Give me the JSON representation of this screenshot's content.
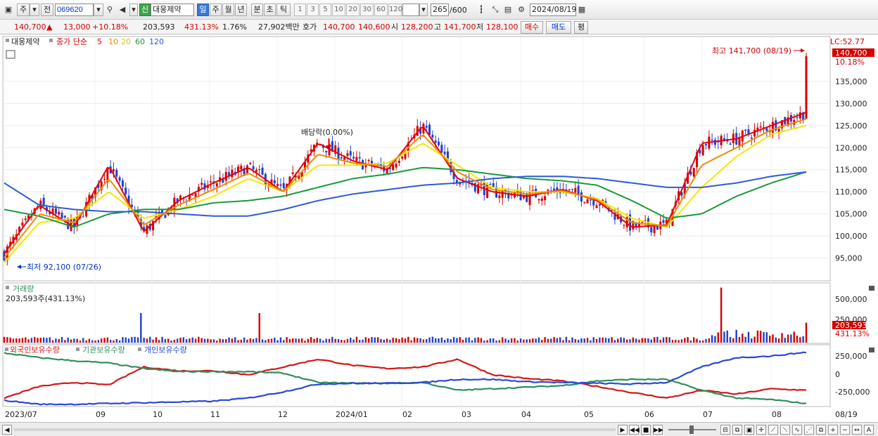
{
  "toolbar": {
    "period_type": "주",
    "compare": "전",
    "stock_code": "069620",
    "badge_new": "신",
    "stock_name": "대웅제약",
    "periods": [
      "일",
      "주",
      "월",
      "년",
      "분",
      "초",
      "틱"
    ],
    "active_period": "일",
    "intervals": [
      "1",
      "3",
      "5",
      "10",
      "20",
      "30",
      "60",
      "120"
    ],
    "count": "265",
    "count_total": "/600",
    "date": "2024/08/19"
  },
  "quote": {
    "price": "140,700",
    "change_arrow": "▲",
    "change": "13,000",
    "change_pct": "+10.18%",
    "volume": "203,593",
    "volume_ratio": "431.13%",
    "turnover": "1.76%",
    "amount": "27,902백만",
    "ask_label": "호가",
    "ask1": "140,700",
    "ask2": "140,600",
    "open_label": "시",
    "open": "128,200",
    "high_label": "고",
    "high": "141,700",
    "low_label": "저",
    "low": "128,100",
    "buy_label": "매수",
    "sell_label": "매도",
    "avg_label": "평"
  },
  "price_panel": {
    "legend_name": "대웅제약",
    "legend_price_type": "종가 단순",
    "ma_periods": [
      "5",
      "10",
      "20",
      "60",
      "120"
    ],
    "lc_label": "LC:52.77",
    "current_price_tag": "140,700",
    "current_pct_tag": "10.18%",
    "high_annotation": "최고 141,700 (08/19)",
    "low_annotation": "최저 92,100 (07/26)",
    "dividend_annotation": "배당락(0.00%)",
    "y_ticks": [
      "135,000",
      "130,000",
      "125,000",
      "120,000",
      "115,000",
      "110,000",
      "105,000",
      "100,000",
      "95,000"
    ]
  },
  "volume_panel": {
    "title": "거래량",
    "current": "203,593주(431.13%)",
    "y_ticks": [
      "500,000",
      "250,000"
    ],
    "tag_value": "203,593",
    "tag_pct": "431.13%"
  },
  "holding_panel": {
    "legend": [
      "외국인보유수량",
      "기관보유수량",
      "개인보유수량"
    ],
    "y_ticks": [
      "250,000",
      "0",
      "-250,000"
    ]
  },
  "x_axis": {
    "labels": [
      "2023/07",
      "09",
      "10",
      "11",
      "12",
      "2024/01",
      "02",
      "03",
      "04",
      "05",
      "06",
      "07",
      "08",
      "08/19"
    ]
  },
  "colors": {
    "up": "#d40000",
    "down": "#1f3fcf",
    "ma5": "#e8000b",
    "ma10": "#f08c00",
    "ma20": "#f5e600",
    "ma60": "#1a9a3a",
    "ma120": "#2e5bd6",
    "foreign": "#d41818",
    "institution": "#2f8f5e",
    "individual": "#2948d8"
  },
  "icons": [
    "chart-type-icon",
    "search-icon",
    "speaker-icon",
    "candle-icon",
    "draw-icon",
    "save-icon",
    "settings-icon",
    "calendar-icon"
  ],
  "chart_data": [
    {
      "type": "line",
      "title": "대웅제약 종가 단순",
      "x": [
        "2023/07",
        "09",
        "10",
        "11",
        "12",
        "2024/01",
        "02",
        "03",
        "04",
        "05",
        "06",
        "07",
        "08",
        "08/19"
      ],
      "series": [
        {
          "name": "5",
          "values": [
            96000,
            107000,
            102000,
            116000,
            101000,
            108000,
            112000,
            115500,
            110000,
            121000,
            117000,
            115000,
            125000,
            113000,
            110000,
            109000,
            110500,
            108000,
            102000,
            102500,
            121000,
            122000,
            125000,
            128000
          ]
        },
        {
          "name": "20",
          "values": [
            94000,
            103000,
            104000,
            110000,
            104000,
            106000,
            109000,
            113000,
            110000,
            116000,
            116000,
            116500,
            121000,
            116000,
            111000,
            110000,
            110000,
            108500,
            104000,
            102000,
            111000,
            118000,
            123000,
            125000
          ]
        },
        {
          "name": "60",
          "values": [
            106000,
            104500,
            102000,
            105000,
            106000,
            106000,
            107500,
            108000,
            109000,
            111000,
            113000,
            114000,
            115500,
            115000,
            114000,
            113000,
            112500,
            111500,
            108000,
            104000,
            105000,
            109000,
            112000,
            114500
          ]
        },
        {
          "name": "120",
          "values": [
            112000,
            107000,
            106000,
            105500,
            105500,
            105000,
            104500,
            104500,
            106000,
            108000,
            109500,
            110500,
            111500,
            112000,
            113000,
            113500,
            113500,
            113000,
            112000,
            111000,
            111000,
            112000,
            113500,
            114500
          ]
        }
      ],
      "ylim": [
        90000,
        145000
      ],
      "high": 141700,
      "low": 92100
    },
    {
      "type": "bar",
      "title": "거래량",
      "last_value": 203593,
      "ylim": [
        0,
        600000
      ]
    },
    {
      "type": "line",
      "title": "보유수량",
      "series": [
        {
          "name": "외국인보유수량",
          "values": [
            -300000,
            -150000,
            -100000,
            -130000,
            100000,
            50000,
            50000,
            0,
            100000,
            200000,
            120000,
            80000,
            100000,
            200000,
            0,
            -50000,
            -80000,
            -150000,
            -230000,
            -300000,
            -200000,
            -250000,
            -180000,
            -200000
          ]
        },
        {
          "name": "기관보유수량",
          "values": [
            280000,
            220000,
            180000,
            150000,
            80000,
            40000,
            40000,
            40000,
            20000,
            -100000,
            -110000,
            -110000,
            -100000,
            -200000,
            -180000,
            -160000,
            -140000,
            -80000,
            -60000,
            -60000,
            -200000,
            -300000,
            -320000,
            -370000
          ]
        },
        {
          "name": "개인보유수량",
          "values": [
            -330000,
            -380000,
            -380000,
            -370000,
            -360000,
            -350000,
            -340000,
            -300000,
            -220000,
            -120000,
            -110000,
            -110000,
            -100000,
            -60000,
            -60000,
            -90000,
            -100000,
            -110000,
            -120000,
            -100000,
            100000,
            220000,
            240000,
            290000
          ]
        }
      ],
      "ylim": [
        -400000,
        350000
      ]
    }
  ]
}
